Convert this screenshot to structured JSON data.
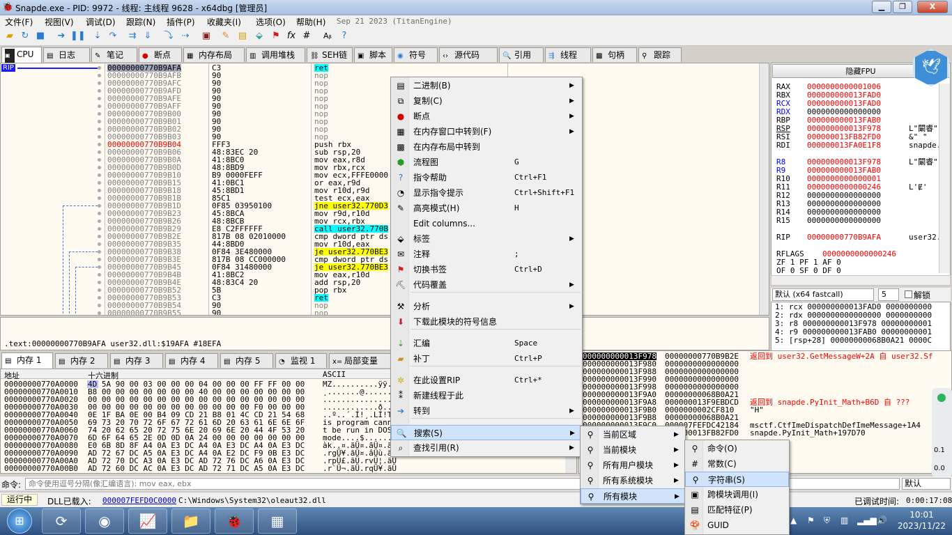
{
  "window": {
    "title": "Snapde.exe - PID: 9972 - 线程: 主线程 9628 - x64dbg [管理员]",
    "min_label": "▁",
    "max_label": "❐",
    "close_label": "X"
  },
  "menubar": {
    "items": [
      "文件(F)",
      "视图(V)",
      "调试(D)",
      "跟踪(N)",
      "插件(P)",
      "收藏夹(I)",
      "选项(O)",
      "帮助(H)"
    ],
    "version": "Sep 21 2023 (TitanEngine)"
  },
  "toolbar": {
    "icons": [
      "open-folder-icon",
      "restart-icon",
      "stop-icon",
      "run-icon",
      "pause-icon",
      "step-into-icon",
      "step-over-icon",
      "trace-into-icon",
      "trace-over-icon",
      "run-to-user-icon",
      "execute-till-return-icon",
      "script-icon",
      "patch-icon",
      "comment-icon",
      "label-icon",
      "bookmark-icon",
      "function-icon",
      "hash-icon",
      "font-icon",
      "help-icon"
    ]
  },
  "tabs": {
    "items": [
      {
        "label": "CPU",
        "icon": "cpu-icon"
      },
      {
        "label": "日志",
        "icon": "log-icon"
      },
      {
        "label": "笔记",
        "icon": "notes-icon"
      },
      {
        "label": "断点",
        "icon": "breakpoint-icon"
      },
      {
        "label": "内存布局",
        "icon": "memory-map-icon"
      },
      {
        "label": "调用堆栈",
        "icon": "call-stack-icon"
      },
      {
        "label": "SEH链",
        "icon": "seh-icon"
      },
      {
        "label": "脚本",
        "icon": "script-icon"
      },
      {
        "label": "符号",
        "icon": "symbols-icon"
      },
      {
        "label": "源代码",
        "icon": "source-icon"
      },
      {
        "label": "引用",
        "icon": "references-icon"
      },
      {
        "label": "线程",
        "icon": "threads-icon"
      },
      {
        "label": "句柄",
        "icon": "handles-icon"
      },
      {
        "label": "跟踪",
        "icon": "trace-icon"
      }
    ]
  },
  "disasm": {
    "rip_label": "RIP",
    "rows": [
      {
        "addr": "00000000770B9AFA",
        "bytes": "C3",
        "instr": "ret",
        "kind": "ret",
        "cur": true
      },
      {
        "addr": "00000000770B9AFB",
        "bytes": "90",
        "instr": "nop",
        "kind": "plain"
      },
      {
        "addr": "00000000770B9AFC",
        "bytes": "90",
        "instr": "nop",
        "kind": "plain"
      },
      {
        "addr": "00000000770B9AFD",
        "bytes": "90",
        "instr": "nop",
        "kind": "plain"
      },
      {
        "addr": "00000000770B9AFE",
        "bytes": "90",
        "instr": "nop",
        "kind": "plain"
      },
      {
        "addr": "00000000770B9AFF",
        "bytes": "90",
        "instr": "nop",
        "kind": "plain"
      },
      {
        "addr": "00000000770B9B00",
        "bytes": "90",
        "instr": "nop",
        "kind": "plain"
      },
      {
        "addr": "00000000770B9B01",
        "bytes": "90",
        "instr": "nop",
        "kind": "plain"
      },
      {
        "addr": "00000000770B9B02",
        "bytes": "90",
        "instr": "nop",
        "kind": "plain"
      },
      {
        "addr": "00000000770B9B03",
        "bytes": "90",
        "instr": "nop",
        "kind": "plain"
      },
      {
        "addr": "00000000770B9B04",
        "bytes": "FFF3",
        "instr": "push rbx",
        "kind": "norm",
        "red": true
      },
      {
        "addr": "00000000770B9B06",
        "bytes": "48:83EC 20",
        "instr": "sub rsp,20",
        "kind": "norm"
      },
      {
        "addr": "00000000770B9B0A",
        "bytes": "41:8BC0",
        "instr": "mov eax,r8d",
        "kind": "norm"
      },
      {
        "addr": "00000000770B9B0D",
        "bytes": "48:8BD9",
        "instr": "mov rbx,rcx",
        "kind": "norm"
      },
      {
        "addr": "00000000770B9B10",
        "bytes": "B9 0000FEFF",
        "instr": "mov ecx,FFFE0000",
        "kind": "norm"
      },
      {
        "addr": "00000000770B9B15",
        "bytes": "41:0BC1",
        "instr": "or eax,r9d",
        "kind": "norm"
      },
      {
        "addr": "00000000770B9B18",
        "bytes": "45:8BD1",
        "instr": "mov r10d,r9d",
        "kind": "norm"
      },
      {
        "addr": "00000000770B9B1B",
        "bytes": "85C1",
        "instr": "test ecx,eax",
        "kind": "norm"
      },
      {
        "addr": "00000000770B9B1D",
        "bytes": "0F85 03950100",
        "instr": "jne user32.770D3",
        "kind": "jmp"
      },
      {
        "addr": "00000000770B9B23",
        "bytes": "45:8BCA",
        "instr": "mov r9d,r10d",
        "kind": "norm"
      },
      {
        "addr": "00000000770B9B26",
        "bytes": "48:8BCB",
        "instr": "mov rcx,rbx",
        "kind": "norm"
      },
      {
        "addr": "00000000770B9B29",
        "bytes": "E8 C2FFFFFF",
        "instr": "call user32.770B",
        "kind": "call"
      },
      {
        "addr": "00000000770B9B2E",
        "bytes": "817B 08 02010000",
        "instr": "cmp dword ptr ds",
        "kind": "norm"
      },
      {
        "addr": "00000000770B9B35",
        "bytes": "44:8BD0",
        "instr": "mov r10d,eax",
        "kind": "norm"
      },
      {
        "addr": "00000000770B9B38",
        "bytes": "0F84 3E480000",
        "instr": "je user32.770BE3",
        "kind": "jmp"
      },
      {
        "addr": "00000000770B9B3E",
        "bytes": "817B 08 CC000000",
        "instr": "cmp dword ptr ds",
        "kind": "norm"
      },
      {
        "addr": "00000000770B9B45",
        "bytes": "0F84 31480000",
        "instr": "je user32.770BE3",
        "kind": "jmp"
      },
      {
        "addr": "00000000770B9B4B",
        "bytes": "41:8BC2",
        "instr": "mov eax,r10d",
        "kind": "norm"
      },
      {
        "addr": "00000000770B9B4E",
        "bytes": "48:83C4 20",
        "instr": "add rsp,20",
        "kind": "norm"
      },
      {
        "addr": "00000000770B9B52",
        "bytes": "5B",
        "instr": "pop rbx",
        "kind": "norm"
      },
      {
        "addr": "00000000770B9B53",
        "bytes": "C3",
        "instr": "ret",
        "kind": "ret"
      },
      {
        "addr": "00000000770B9B54",
        "bytes": "90",
        "instr": "nop",
        "kind": "plain"
      },
      {
        "addr": "00000000770B9B55",
        "bytes": "90",
        "instr": "nop",
        "kind": "plain"
      }
    ]
  },
  "infobar": {
    "text": ".text:00000000770B9AFA user32.dll:$19AFA #18EFA"
  },
  "registers": {
    "hide_fpu_label": "隐藏FPU",
    "rows": [
      {
        "name": "RAX",
        "value": "0000000000001006",
        "comment": "",
        "red": true
      },
      {
        "name": "RBX",
        "value": "000000000013FAD0",
        "comment": "",
        "red": true
      },
      {
        "name": "RCX",
        "value": "000000000013FAD0",
        "comment": "",
        "red": true,
        "nameblue": true
      },
      {
        "name": "RDX",
        "value": "0000000000000000",
        "comment": "",
        "red": false,
        "nameblue": true
      },
      {
        "name": "RBP",
        "value": "000000000013FAB0",
        "comment": "",
        "red": true
      },
      {
        "name": "RSP",
        "value": "000000000013F978",
        "comment": "L\"闞睿\"",
        "red": true
      },
      {
        "name": "RSI",
        "value": "000000013FB82FD0",
        "comment": "&\" \"",
        "red": true
      },
      {
        "name": "RDI",
        "value": "000000013FA0E1F8",
        "comment": "snapde.",
        "red": true
      },
      {
        "name": "",
        "value": "",
        "comment": ""
      },
      {
        "name": "R8",
        "value": "000000000013F978",
        "comment": "L\"闞睿\"",
        "red": true,
        "nameblue": true
      },
      {
        "name": "R9",
        "value": "000000000013FAB0",
        "comment": "",
        "red": true,
        "nameblue": true
      },
      {
        "name": "R10",
        "value": "0000000000000001",
        "comment": "",
        "red": true
      },
      {
        "name": "R11",
        "value": "0000000000000246",
        "comment": "L'Ɇ'",
        "red": true
      },
      {
        "name": "R12",
        "value": "0000000000000000",
        "comment": "",
        "red": false
      },
      {
        "name": "R13",
        "value": "0000000000000000",
        "comment": "",
        "red": false
      },
      {
        "name": "R14",
        "value": "0000000000000000",
        "comment": "",
        "red": false
      },
      {
        "name": "R15",
        "value": "0000000000000000",
        "comment": "",
        "red": false
      },
      {
        "name": "",
        "value": "",
        "comment": ""
      },
      {
        "name": "RIP",
        "value": "00000000770B9AFA",
        "comment": "user32.",
        "red": true
      },
      {
        "name": "",
        "value": "",
        "comment": ""
      },
      {
        "name": "RFLAGS",
        "value": "0000000000000246",
        "comment": "",
        "red": true,
        "wide": true
      },
      {
        "name": "ZF 1  PF 1  AF 0",
        "value": "",
        "comment": ""
      },
      {
        "name": "OF 0  SF 0  DF 0",
        "value": "",
        "comment": ""
      }
    ]
  },
  "callconv": {
    "selected": "默认 (x64 fastcall)",
    "count": "5",
    "unlock_label": "解锁"
  },
  "stack_args": [
    "1: rcx 000000000013FAD0 0000000000",
    "2: rdx 0000000000000000 0000000000",
    "3: r8 000000000013F978 00000000001",
    "4: r9 000000000013FAB0 00000000001",
    "5: [rsp+28] 00000000068B0A21 0000C"
  ],
  "memtabs": {
    "items": [
      {
        "label": "内存 1",
        "icon": "dump-icon"
      },
      {
        "label": "内存 2",
        "icon": "dump-icon"
      },
      {
        "label": "内存 3",
        "icon": "dump-icon"
      },
      {
        "label": "内存 4",
        "icon": "dump-icon"
      },
      {
        "label": "内存 5",
        "icon": "dump-icon"
      },
      {
        "label": "监视 1",
        "icon": "watch-icon"
      },
      {
        "label": "局部变量",
        "icon": "locals-icon"
      }
    ]
  },
  "dump": {
    "headers": {
      "addr": "地址",
      "hex": "十六进制",
      "ascii": "ASCII"
    },
    "rows": [
      {
        "addr": "00000000770A0000",
        "hex": "4D 5A 90 00 03 00 00 00 04 00 00 00 FF FF 00 00",
        "ascii": "MZ..........ÿÿ.."
      },
      {
        "addr": "00000000770A0010",
        "hex": "B8 00 00 00 00 00 00 00 40 00 00 00 00 00 00 00",
        "ascii": "¸.......@......."
      },
      {
        "addr": "00000000770A0020",
        "hex": "00 00 00 00 00 00 00 00 00 00 00 00 00 00 00 00",
        "ascii": "................"
      },
      {
        "addr": "00000000770A0030",
        "hex": "00 00 00 00 00 00 00 00 00 00 00 00 F0 00 00 00",
        "ascii": "............ð..."
      },
      {
        "addr": "00000000770A0040",
        "hex": "0E 1F BA 0E 00 B4 09 CD 21 B8 01 4C CD 21 54 68",
        "ascii": "..º..´.Í!¸.LÍ!Th"
      },
      {
        "addr": "00000000770A0050",
        "hex": "69 73 20 70 72 6F 67 72 61 6D 20 63 61 6E 6E 6F",
        "ascii": "is program canno"
      },
      {
        "addr": "00000000770A0060",
        "hex": "74 20 62 65 20 72 75 6E 20 69 6E 20 44 4F 53 20",
        "ascii": "t be run in DOS "
      },
      {
        "addr": "00000000770A0070",
        "hex": "6D 6F 64 65 2E 0D 0D 0A 24 00 00 00 00 00 00 00",
        "ascii": "mode....$......."
      },
      {
        "addr": "00000000770A0080",
        "hex": "E0 6B 8D 8F A4 0A E3 DC A4 0A E3 DC A4 0A E3 DC",
        "ascii": "àk..¤.ãÜ¤.ãÜ¤.ãÜ"
      },
      {
        "addr": "00000000770A0090",
        "hex": "AD 72 67 DC A5 0A E3 DC A4 0A E2 DC F9 0B E3 DC",
        "ascii": ".rgÜ¥.ãÜ¤.âÜù.ãÜ"
      },
      {
        "addr": "00000000770A00A0",
        "hex": "AD 72 70 DC A3 0A E3 DC AD 72 76 DC A6 0A E3 DC",
        "ascii": ".rpÜ£.ãÜ.rvÜ¦.ãÜ"
      },
      {
        "addr": "00000000770A00B0",
        "hex": "AD 72 60 DC AC 0A E3 DC AD 72 71 DC A5 0A E3 DC",
        "ascii": ".r`Ü¬.ãÜ.rqÜ¥.ãÜ"
      }
    ]
  },
  "stack": {
    "rows": [
      {
        "addr": "000000000013F978",
        "value": "00000000770B9B2E",
        "comment": "返回到 user32.GetMessageW+2A 自 user32.Sf",
        "cur": true
      },
      {
        "addr": "000000000013F980",
        "value": "0000000000000000",
        "comment": ""
      },
      {
        "addr": "000000000013F988",
        "value": "0000000000000000",
        "comment": ""
      },
      {
        "addr": "000000000013F990",
        "value": "0000000000000000",
        "comment": ""
      },
      {
        "addr": "000000000013F998",
        "value": "0000000000000000",
        "comment": ""
      },
      {
        "addr": "000000000013F9A0",
        "value": "00000000068B0A21",
        "comment": ""
      },
      {
        "addr": "000000000013F9A8",
        "value": "000000013F9EBDCD",
        "comment": "返回到 snapde.PyInit_Math+B6D 自 ???",
        "red": true
      },
      {
        "addr": "000000000013F9B0",
        "value": "0000000002CF810",
        "comment": "\"H\""
      },
      {
        "addr": "000000000013F9B8",
        "value": "00000000068B0A21",
        "comment": ""
      },
      {
        "addr": "000000000013F9C0",
        "value": "000007FEFDC42184",
        "comment": "msctf.CtfImeDispatchDefImeMessage+1A4"
      },
      {
        "addr": "000000000013F9C8",
        "value": "000000013FB82FD0",
        "comment": "snapde.PyInit_Math+197D70"
      }
    ]
  },
  "command": {
    "label": "命令:",
    "placeholder": "命令使用逗号分隔(像汇编语言): mov eax, ebx",
    "mode": "默认"
  },
  "status": {
    "state": "运行中",
    "dll_label": "DLL已载入:",
    "dll_addr": "000007FEFD0C0000",
    "dll_path": "C:\\Windows\\System32\\oleaut32.dll",
    "elapsed_label": "已调试时间:",
    "elapsed": "0:00:17:08"
  },
  "taskbar": {
    "time": "10:01",
    "date": "2023/11/22",
    "apps": [
      "start-orb-icon",
      "refresh-app-icon",
      "obs-icon",
      "chart-app-icon",
      "explorer-icon",
      "x64dbg-icon",
      "notepad-icon"
    ]
  },
  "context_menu": {
    "items": [
      {
        "label": "二进制(B)",
        "icon": "binary-icon",
        "sub": true
      },
      {
        "label": "复制(C)",
        "icon": "copy-icon",
        "sub": true
      },
      {
        "label": "断点",
        "icon": "breakpoint-dot-icon",
        "sub": true
      },
      {
        "label": "在内存窗口中转到(F)",
        "icon": "dump-goto-icon",
        "sub": true
      },
      {
        "label": "在内存布局中转到",
        "icon": "memmap-goto-icon"
      },
      {
        "label": "流程图",
        "icon": "graph-icon",
        "shortcut": "G"
      },
      {
        "label": "指令帮助",
        "icon": "help-book-icon",
        "shortcut": "Ctrl+F1"
      },
      {
        "label": "显示指令提示",
        "icon": "tip-icon",
        "shortcut": "Ctrl+Shift+F1"
      },
      {
        "label": "高亮模式(H)",
        "icon": "highlight-icon",
        "shortcut": "H"
      },
      {
        "label": "Edit columns...",
        "icon": ""
      },
      {
        "label": "标签",
        "icon": "label-tag-icon",
        "sub": true
      },
      {
        "label": "注释",
        "icon": "comment-bubble-icon",
        "shortcut": ";"
      },
      {
        "label": "切换书签",
        "icon": "bookmark-toggle-icon",
        "shortcut": "Ctrl+D"
      },
      {
        "label": "代码覆盖",
        "icon": "coverage-icon",
        "sub": true
      },
      {
        "label": "分析",
        "icon": "analyze-icon",
        "sub": true
      },
      {
        "label": "下载此模块的符号信息",
        "icon": "download-symbols-icon"
      },
      {
        "label": "汇编",
        "icon": "assemble-icon",
        "shortcut": "Space"
      },
      {
        "label": "补丁",
        "icon": "patch-bandage-icon",
        "shortcut": "Ctrl+P"
      },
      {
        "label": "在此设置RIP",
        "icon": "set-rip-icon",
        "shortcut": "Ctrl+*"
      },
      {
        "label": "新建线程于此",
        "icon": "new-thread-icon"
      },
      {
        "label": "转到",
        "icon": "goto-icon",
        "sub": true
      },
      {
        "label": "搜索(S)",
        "icon": "search-icon",
        "sub": true,
        "highlight": true
      },
      {
        "label": "查找引用(R)",
        "icon": "find-refs-icon",
        "sub": true
      }
    ],
    "search_sub": [
      {
        "label": "当前区域",
        "icon": "search-region-icon"
      },
      {
        "label": "当前模块",
        "icon": "search-module-icon"
      },
      {
        "label": "所有用户模块",
        "icon": "search-user-modules-icon"
      },
      {
        "label": "所有系统模块",
        "icon": "search-system-modules-icon"
      },
      {
        "label": "所有模块",
        "icon": "search-all-modules-icon",
        "highlight": true
      }
    ],
    "allmod_sub": [
      {
        "label": "命令(O)",
        "icon": "search-command-icon"
      },
      {
        "label": "常数(C)",
        "icon": "search-constant-icon"
      },
      {
        "label": "字符串(S)",
        "icon": "search-string-icon",
        "highlight": true
      },
      {
        "label": "跨模块调用(I)",
        "icon": "intermodular-call-icon"
      },
      {
        "label": "匹配特征(P)",
        "icon": "pattern-icon"
      },
      {
        "label": "GUID",
        "icon": "guid-icon"
      }
    ]
  },
  "sidewidget": {
    "values": [
      "0.1",
      "0.0"
    ]
  }
}
